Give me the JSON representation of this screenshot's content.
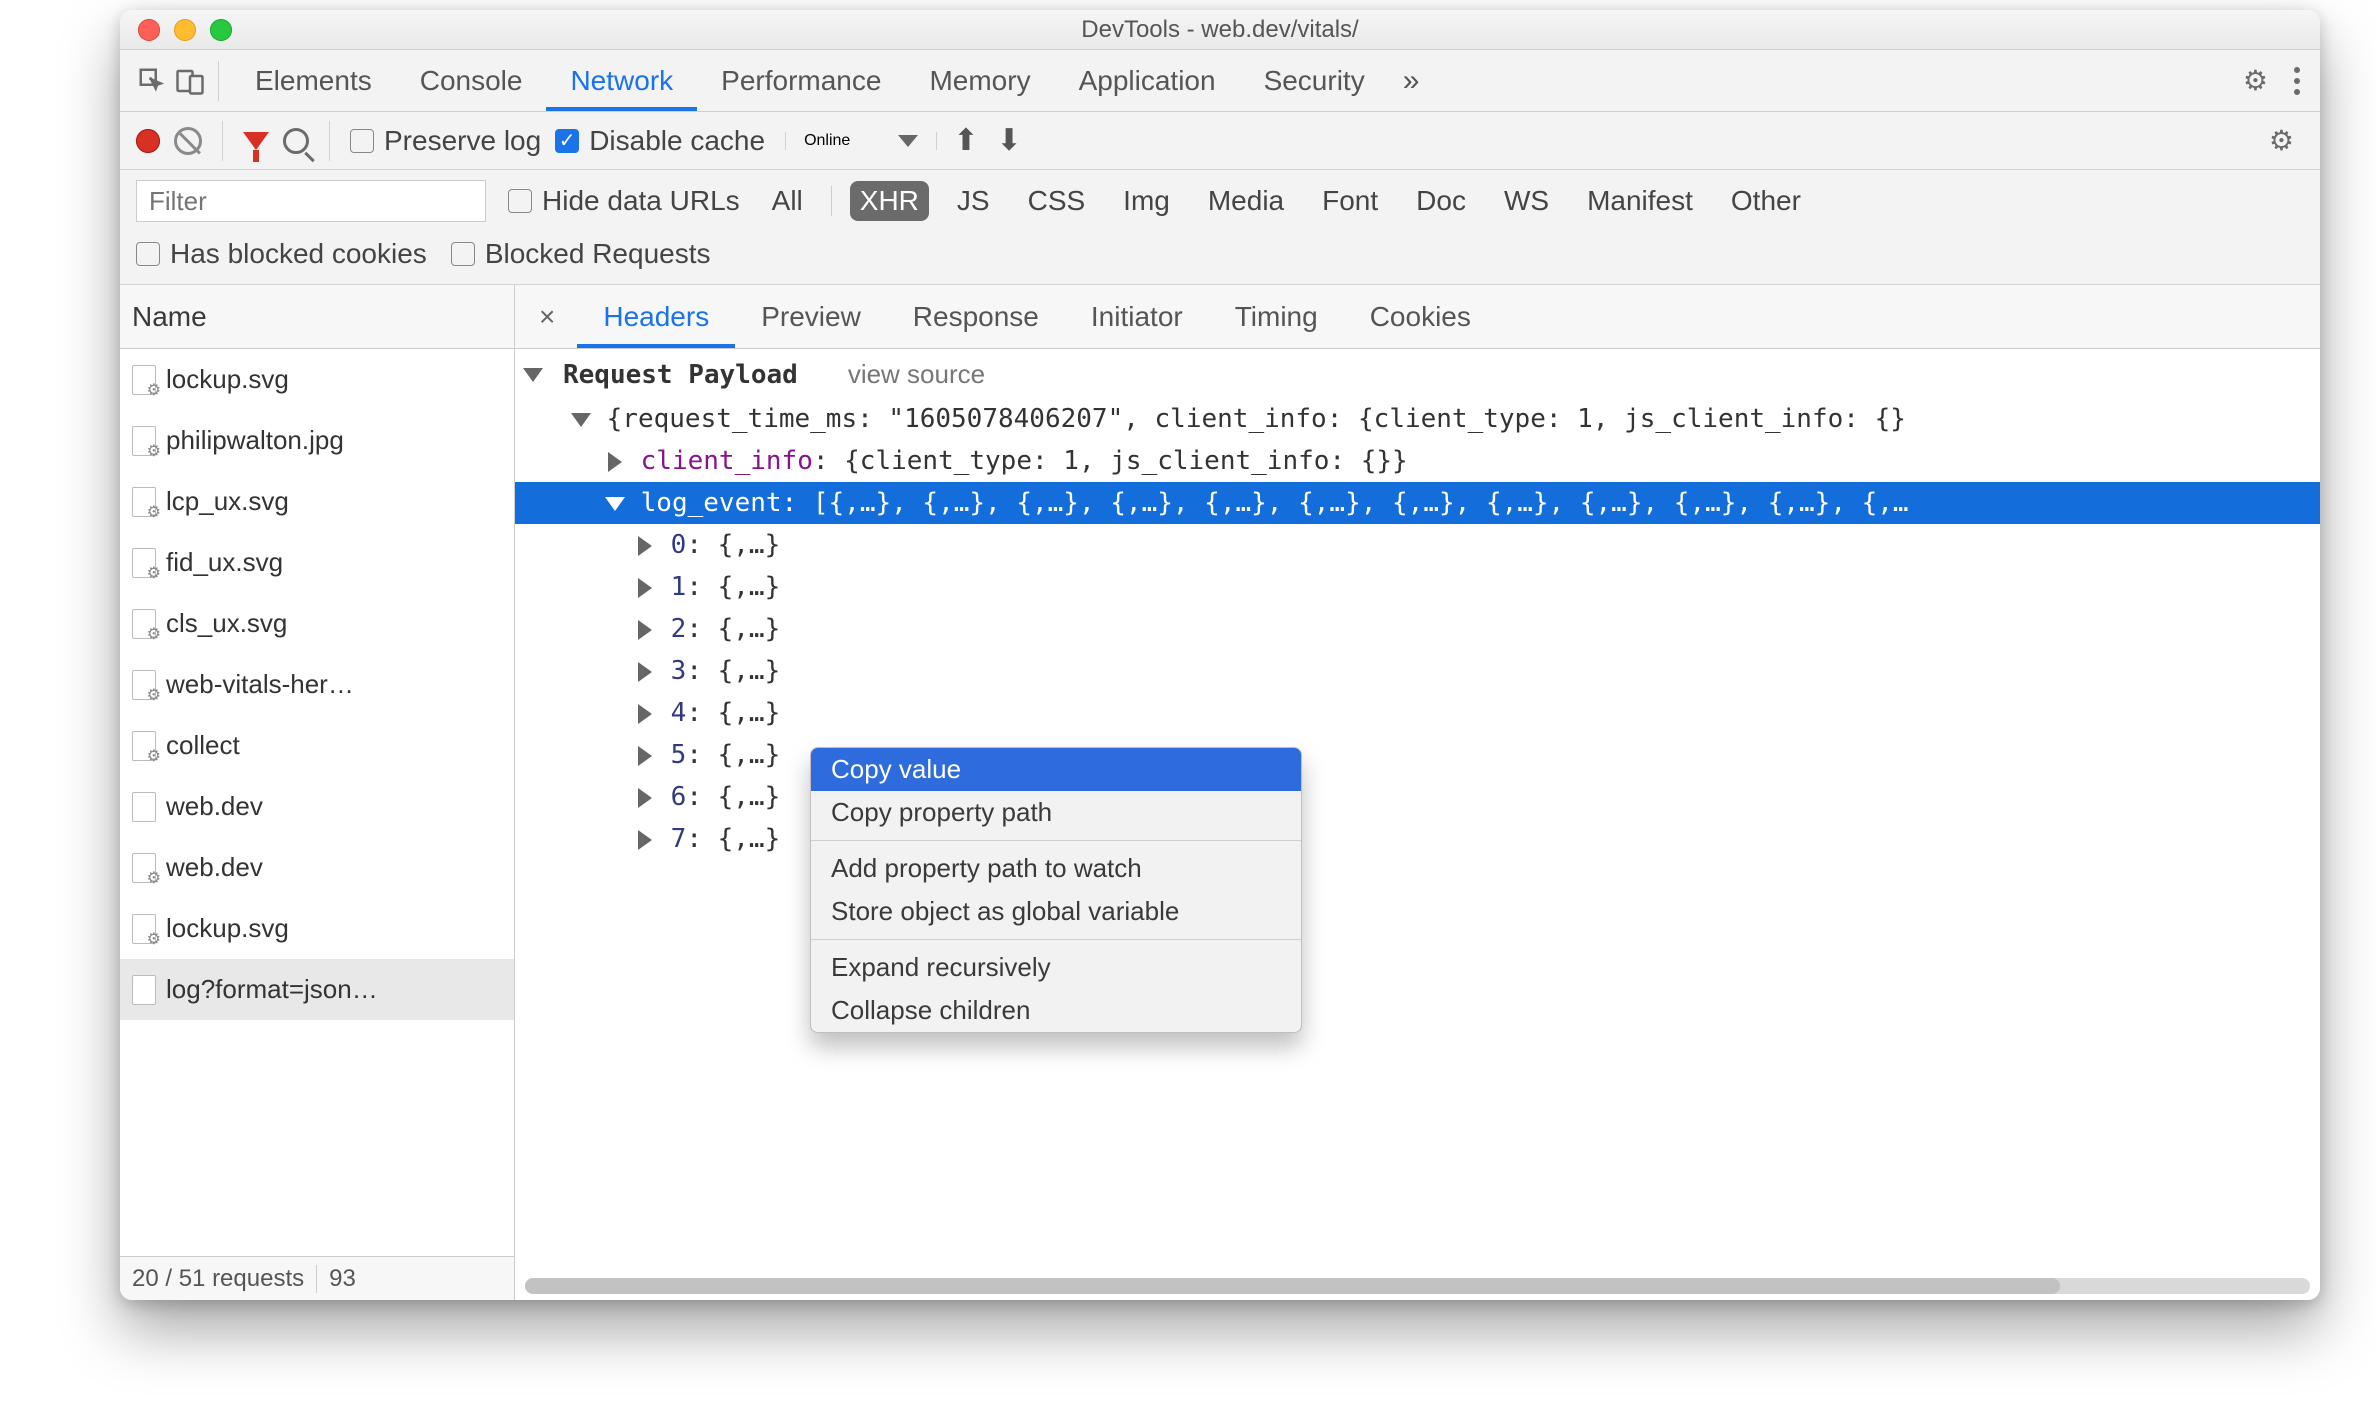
{
  "window": {
    "title": "DevTools - web.dev/vitals/"
  },
  "main_tabs": {
    "items": [
      "Elements",
      "Console",
      "Network",
      "Performance",
      "Memory",
      "Application",
      "Security"
    ],
    "active_index": 2
  },
  "net_toolbar": {
    "preserve_log": {
      "label": "Preserve log",
      "checked": false
    },
    "disable_cache": {
      "label": "Disable cache",
      "checked": true
    },
    "throttle": "Online"
  },
  "filter": {
    "placeholder": "Filter",
    "hide_data_urls": {
      "label": "Hide data URLs",
      "checked": false
    },
    "types": [
      "All",
      "XHR",
      "JS",
      "CSS",
      "Img",
      "Media",
      "Font",
      "Doc",
      "WS",
      "Manifest",
      "Other"
    ],
    "active_type_index": 1,
    "has_blocked_cookies": {
      "label": "Has blocked cookies",
      "checked": false
    },
    "blocked_requests": {
      "label": "Blocked Requests",
      "checked": false
    }
  },
  "requests": {
    "header": "Name",
    "items": [
      {
        "name": "lockup.svg",
        "gear": true
      },
      {
        "name": "philipwalton.jpg",
        "gear": true
      },
      {
        "name": "lcp_ux.svg",
        "gear": true
      },
      {
        "name": "fid_ux.svg",
        "gear": true
      },
      {
        "name": "cls_ux.svg",
        "gear": true
      },
      {
        "name": "web-vitals-her…",
        "gear": true
      },
      {
        "name": "collect",
        "gear": true
      },
      {
        "name": "web.dev",
        "gear": false
      },
      {
        "name": "web.dev",
        "gear": true
      },
      {
        "name": "lockup.svg",
        "gear": true
      },
      {
        "name": "log?format=json…",
        "gear": false,
        "selected": true
      }
    ],
    "status": {
      "left": "20 / 51 requests",
      "right": "93"
    }
  },
  "detail_tabs": {
    "items": [
      "Headers",
      "Preview",
      "Response",
      "Initiator",
      "Timing",
      "Cookies"
    ],
    "active_index": 0
  },
  "payload": {
    "section_title": "Request Payload",
    "view_source": "view source",
    "root_line": "{request_time_ms: \"1605078406207\", client_info: {client_type: 1, js_client_info: {}",
    "client_info_key": "client_info",
    "client_info_line": ": {client_type: 1, js_client_info: {}}",
    "log_event_key": "log_event",
    "log_event_line": ": [{,…}, {,…}, {,…}, {,…},  {,…}, {,…}, {,…}, {,…}, {,…}, {,…}, {,…}, {,…",
    "children": [
      {
        "idx": "0",
        "val": "{,…}"
      },
      {
        "idx": "1",
        "val": "{,…}"
      },
      {
        "idx": "2",
        "val": "{,…}"
      },
      {
        "idx": "3",
        "val": "{,…}"
      },
      {
        "idx": "4",
        "val": "{,…}"
      },
      {
        "idx": "5",
        "val": "{,…}"
      },
      {
        "idx": "6",
        "val": "{,…}"
      },
      {
        "idx": "7",
        "val": "{,…}"
      }
    ]
  },
  "context_menu": {
    "items": [
      "Copy value",
      "Copy property path",
      "-",
      "Add property path to watch",
      "Store object as global variable",
      "-",
      "Expand recursively",
      "Collapse children"
    ],
    "highlight_index": 0
  }
}
